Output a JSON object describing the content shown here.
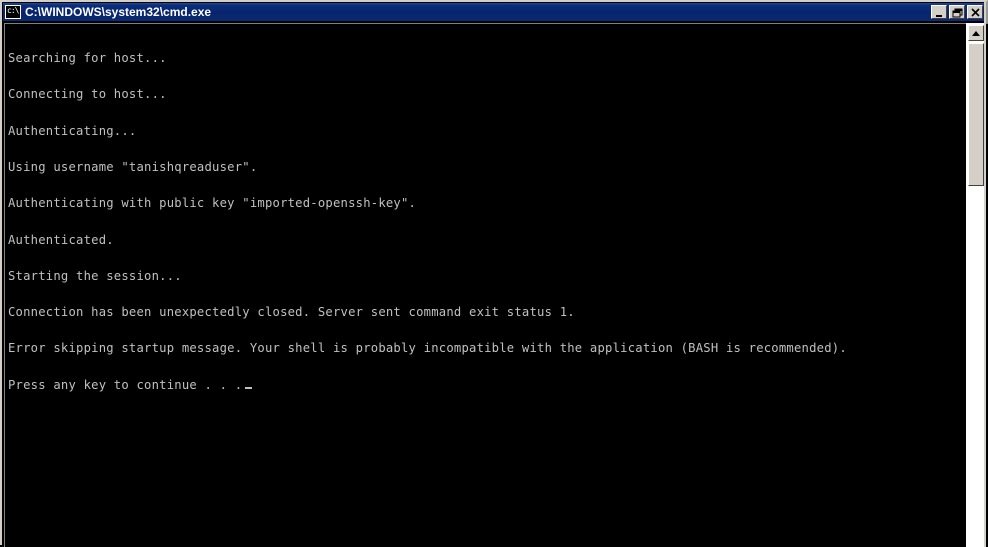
{
  "window": {
    "title": "C:\\WINDOWS\\system32\\cmd.exe",
    "icon_name": "console-icon",
    "icon_glyph": "c:\\",
    "colors": {
      "titlebar": "#0a246a",
      "frame": "#d4d0c8",
      "console_background": "#000000",
      "console_text": "#c0c0c0"
    },
    "buttons": {
      "minimize_label": "Minimize",
      "restore_label": "Restore",
      "close_label": "Close"
    }
  },
  "console": {
    "lines": [
      "Searching for host...",
      "Connecting to host...",
      "Authenticating...",
      "Using username \"tanishqreaduser\".",
      "Authenticating with public key \"imported-openssh-key\".",
      "Authenticated.",
      "Starting the session...",
      "Connection has been unexpectedly closed. Server sent command exit status 1.",
      "Error skipping startup message. Your shell is probably incompatible with the application (BASH is recommended).",
      "Press any key to continue . . ."
    ]
  },
  "scrollbar": {
    "up_arrow_name": "scroll-up-arrow",
    "thumb_name": "scroll-thumb"
  }
}
